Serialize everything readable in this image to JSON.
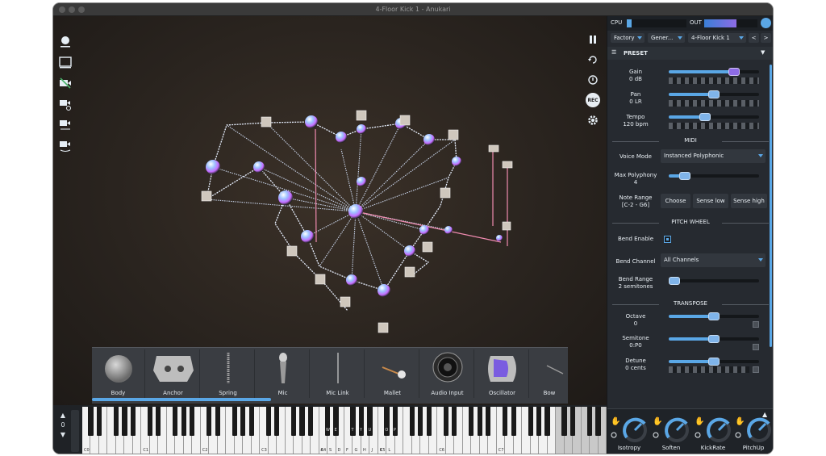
{
  "window": {
    "title": "4-Floor Kick 1 - Anukari"
  },
  "meters": {
    "cpu_label": "CPU",
    "out_label": "OUT"
  },
  "preset_bar": {
    "bank": "Factory",
    "category": "Gener...",
    "preset": "4-Floor Kick 1",
    "prev": "<",
    "next": ">"
  },
  "preset_section": {
    "label": "PRESET"
  },
  "params": {
    "gain": {
      "label": "Gain",
      "value": "0 dB",
      "level": 0.72
    },
    "pan": {
      "label": "Pan",
      "value": "0 LR",
      "level": 0.5
    },
    "tempo": {
      "label": "Tempo",
      "value": "120 bpm",
      "level": 0.4
    }
  },
  "midi": {
    "title": "MIDI",
    "voice_mode_label": "Voice Mode",
    "voice_mode_value": "Instanced Polyphonic",
    "max_poly_label": "Max Polyphony",
    "max_poly_value": "4",
    "max_poly_level": 0.18,
    "note_range_label": "Note Range",
    "note_range_value": "[C-2 - G6]",
    "choose": "Choose",
    "sense_low": "Sense low",
    "sense_high": "Sense high"
  },
  "pitch_wheel": {
    "title": "PITCH WHEEL",
    "bend_enable_label": "Bend Enable",
    "bend_channel_label": "Bend Channel",
    "bend_channel_value": "All Channels",
    "bend_range_label": "Bend Range",
    "bend_range_value": "2 semitones",
    "bend_range_level": 0.0
  },
  "transpose": {
    "title": "TRANSPOSE",
    "octave": {
      "label": "Octave",
      "value": "0",
      "level": 0.5
    },
    "semitone": {
      "label": "Semitone",
      "value": "0:P0",
      "level": 0.5
    },
    "detune": {
      "label": "Detune",
      "value": "0 cents",
      "level": 0.5
    }
  },
  "palette": [
    "Body",
    "Anchor",
    "Spring",
    "Mic",
    "Mic Link",
    "Mallet",
    "Audio Input",
    "Oscillator",
    "Bow"
  ],
  "keyboard": {
    "octave_value": "0",
    "octave_labels": [
      "C0",
      "C1",
      "C2",
      "C3",
      "C4",
      "C5",
      "C6",
      "C7"
    ],
    "qwerty_labels": [
      "A",
      "S",
      "D",
      "F",
      "G",
      "H",
      "J",
      "K",
      "L"
    ],
    "qwerty_black_labels": [
      "W",
      "E",
      "T",
      "Y",
      "U",
      "O",
      "P"
    ]
  },
  "macros": [
    "Isotropy",
    "Soften",
    "KickRate",
    "PitchUp"
  ],
  "colors": {
    "accent": "#5aa7e6",
    "purple": "#8d6be6",
    "panel": "#262a30"
  },
  "side_toolbar": [
    "record-view-icon",
    "window-icon",
    "camera-off-icon",
    "camera-add-icon",
    "camera-swap-icon",
    "camera-rotate-icon"
  ]
}
